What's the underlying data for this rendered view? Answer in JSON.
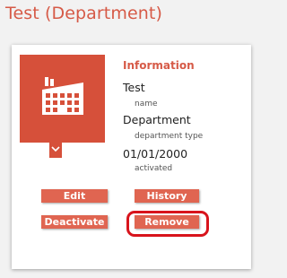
{
  "page": {
    "title": "Test (Department)"
  },
  "card": {
    "icon": "factory-icon",
    "toggle_icon": "chevron-down-icon",
    "info_heading": "Information",
    "fields": [
      {
        "value": "Test",
        "label": "name"
      },
      {
        "value": "Department",
        "label": "department type"
      },
      {
        "value": "01/01/2000",
        "label": "activated"
      }
    ],
    "actions": {
      "edit": "Edit",
      "history": "History",
      "deactivate": "Deactivate",
      "remove": "Remove"
    }
  },
  "colors": {
    "accent": "#d65a47",
    "tile": "#d6503a",
    "button": "#e06551",
    "highlight": "#d8141c"
  }
}
